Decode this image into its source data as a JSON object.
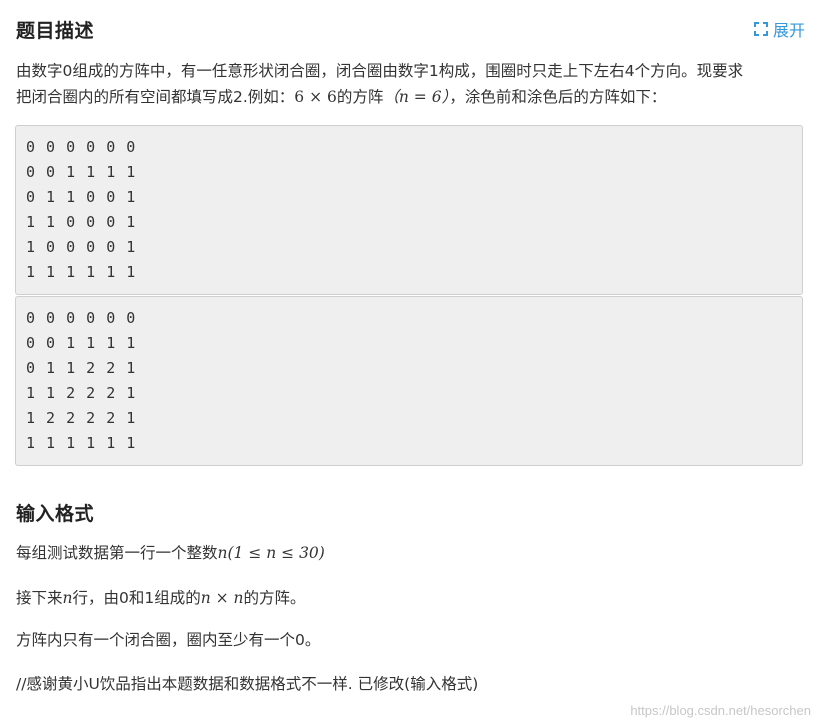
{
  "description": {
    "title": "题目描述",
    "expand_label": "展开",
    "paragraph_line1": "由数字0组成的方阵中，有一任意形状闭合圈，闭合圈由数字1构成，围圈时只走上下左右4个方向。现要求",
    "paragraph_line2_a": "把闭合圈内的所有空间都填写成2.例如：",
    "paragraph_line2_math1": "6 × 6",
    "paragraph_line2_b": "的方阵",
    "paragraph_line2_math2": "（n = 6）",
    "paragraph_line2_c": "，涂色前和涂色后的方阵如下："
  },
  "before_matrix": [
    "0 0 0 0 0 0",
    "0 0 1 1 1 1",
    "0 1 1 0 0 1",
    "1 1 0 0 0 1",
    "1 0 0 0 0 1",
    "1 1 1 1 1 1"
  ],
  "after_matrix": [
    "0 0 0 0 0 0",
    "0 0 1 1 1 1",
    "0 1 1 2 2 1",
    "1 1 2 2 2 1",
    "1 2 2 2 2 1",
    "1 1 1 1 1 1"
  ],
  "input_format": {
    "title": "输入格式",
    "line1_a": "每组测试数据第一行一个整数",
    "line1_math": "n(1 ≤ n ≤ 30)",
    "line2_a": "接下来",
    "line2_math1": "n",
    "line2_b": "行，由0和1组成的",
    "line2_math2": "n × n",
    "line2_c": "的方阵。",
    "line3": "方阵内只有一个闭合圈，圈内至少有一个0。",
    "line4": "//感谢黄小U饮品指出本题数据和数据格式不一样. 已修改(输入格式)"
  },
  "watermark": "https://blog.csdn.net/hesorchen",
  "colors": {
    "accent": "#3498db",
    "code_bg": "#efefef",
    "code_border": "#cfcfcf",
    "text": "#333333"
  },
  "icons": {
    "expand": "expand-corners-icon"
  }
}
